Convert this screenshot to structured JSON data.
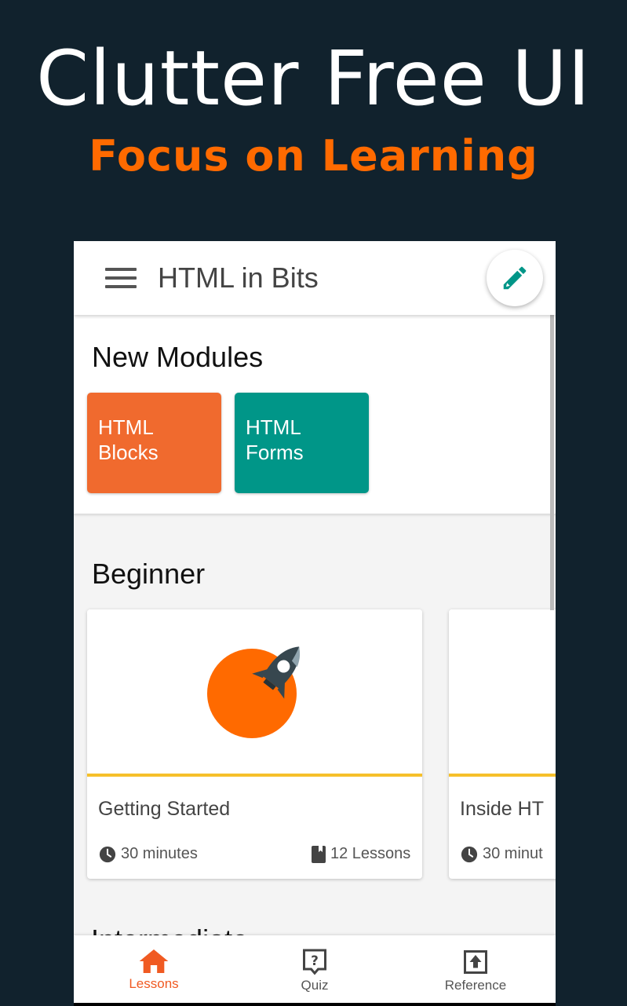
{
  "promo": {
    "title": "Clutter Free UI",
    "subtitle": "Focus on Learning",
    "title_color": "#ffffff",
    "subtitle_color": "#ff6a00",
    "background": "#11222d"
  },
  "appbar": {
    "title": "HTML in Bits",
    "menu_icon": "hamburger-menu-icon",
    "edit_icon": "pencil-icon",
    "edit_icon_color": "#009688"
  },
  "new_modules": {
    "heading": "New Modules",
    "tiles": [
      {
        "line1": "HTML",
        "line2": "Blocks",
        "color": "#f06a2e"
      },
      {
        "line1": "HTML",
        "line2": "Forms",
        "color": "#009688"
      }
    ]
  },
  "beginner": {
    "heading": "Beginner",
    "cards": [
      {
        "title": "Getting Started",
        "duration": "30 minutes",
        "lessons": "12 Lessons",
        "icon": "rocket-icon"
      },
      {
        "title": "Inside HT",
        "duration": "30 minut"
      }
    ]
  },
  "next_section": {
    "heading": "Intermediate"
  },
  "bottom_nav": {
    "items": [
      {
        "label": "Lessons",
        "icon": "home-icon",
        "active": true
      },
      {
        "label": "Quiz",
        "icon": "quiz-icon",
        "active": false
      },
      {
        "label": "Reference",
        "icon": "reference-icon",
        "active": false
      }
    ],
    "active_color": "#f05a22",
    "inactive_color": "#555555"
  }
}
